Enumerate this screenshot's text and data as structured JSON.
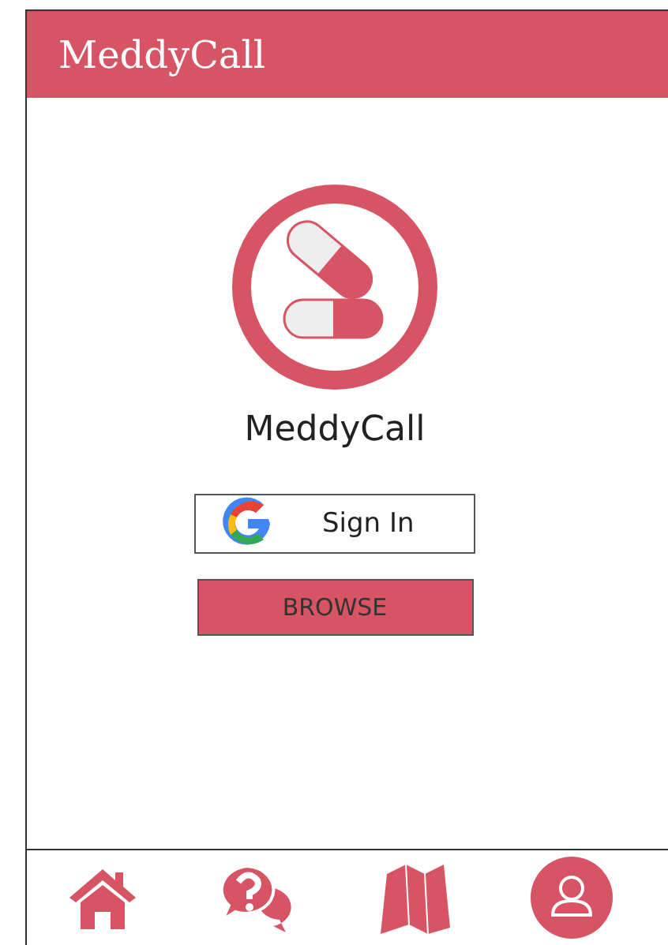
{
  "header": {
    "title": "MeddyCall"
  },
  "logo": {
    "caption": "MeddyCall"
  },
  "buttons": [
    {
      "kind": "google",
      "label": "Sign In"
    },
    {
      "kind": "primary",
      "label": "BROWSE"
    }
  ],
  "nav": [
    {
      "kind": "home"
    },
    {
      "kind": "help"
    },
    {
      "kind": "map"
    },
    {
      "kind": "profile"
    }
  ]
}
